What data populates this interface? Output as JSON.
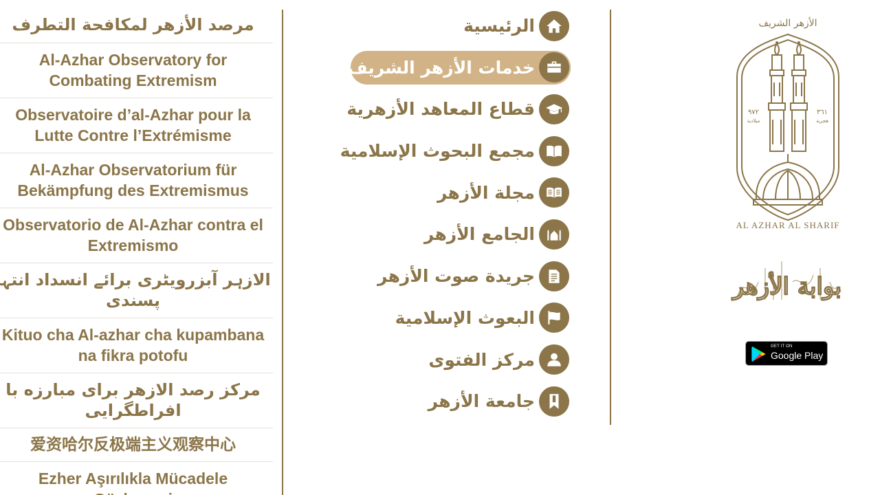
{
  "observatory": {
    "items": [
      {
        "lines": [
          "مرصد الأزهر لمكافحة التطرف"
        ],
        "lang": "ar"
      },
      {
        "lines": [
          "Al-Azhar Observatory for",
          "Combating Extremism"
        ],
        "lang": "en"
      },
      {
        "lines": [
          "Observatoire d’al-Azhar pour la",
          "Lutte Contre l’Extrémisme"
        ],
        "lang": "fr"
      },
      {
        "lines": [
          "Al-Azhar Observatorium für",
          "Bekämpfung des Extremismus"
        ],
        "lang": "de"
      },
      {
        "lines": [
          "Observatorio de Al-Azhar contra el",
          "Extremismo"
        ],
        "lang": "es"
      },
      {
        "lines": [
          "الازہر آبزرویٹری برائے انسداد انتہا",
          "پسندی"
        ],
        "lang": "ur"
      },
      {
        "lines": [
          "Kituo cha Al-azhar cha kupambana",
          "na fikra potofu"
        ],
        "lang": "sw"
      },
      {
        "lines": [
          "مرکز رصد الازهر برای مبارزه با",
          "افراطگرایی"
        ],
        "lang": "fa"
      },
      {
        "lines": [
          "爱资哈尔反极端主义观察中心"
        ],
        "lang": "zh"
      },
      {
        "lines": [
          "Ezher Aşırılıkla Mücadele",
          "Gözlemevi"
        ],
        "lang": "tr"
      }
    ]
  },
  "nav": {
    "items": [
      {
        "label": "الرئيسية",
        "icon": "home-icon"
      },
      {
        "label": "خدمات الأزهر الشريف",
        "icon": "briefcase-icon",
        "active": true
      },
      {
        "label": "قطاع المعاهد الأزهرية",
        "icon": "graduation-cap-icon"
      },
      {
        "label": "مجمع البحوث الإسلامية",
        "icon": "open-book-icon"
      },
      {
        "label": "مجلة الأزهر",
        "icon": "magazine-icon"
      },
      {
        "label": "الجامع الأزهر",
        "icon": "mosque-icon"
      },
      {
        "label": "جريدة صوت الأزهر",
        "icon": "newspaper-icon"
      },
      {
        "label": "البعوث الإسلامية",
        "icon": "flag-icon"
      },
      {
        "label": "مركز الفتوى",
        "icon": "person-icon"
      },
      {
        "label": "جامعة الأزهر",
        "icon": "bookmark-icon"
      }
    ]
  },
  "logo": {
    "top_text": "الأزهر الشريف",
    "left_year": "٩٧٢",
    "left_caption": "ميلادية",
    "right_year": "٣٦١",
    "right_caption": "هجرية",
    "bottom_text": "AL AZHAR AL SHARIF",
    "calligraphy": "بوابة الأزهر"
  },
  "play_badge": {
    "small": "GET IT ON",
    "big": "Google Play"
  },
  "colors": {
    "brand": "#8b7549",
    "active_pill": "#d2b387",
    "divider": "#8b7549"
  }
}
